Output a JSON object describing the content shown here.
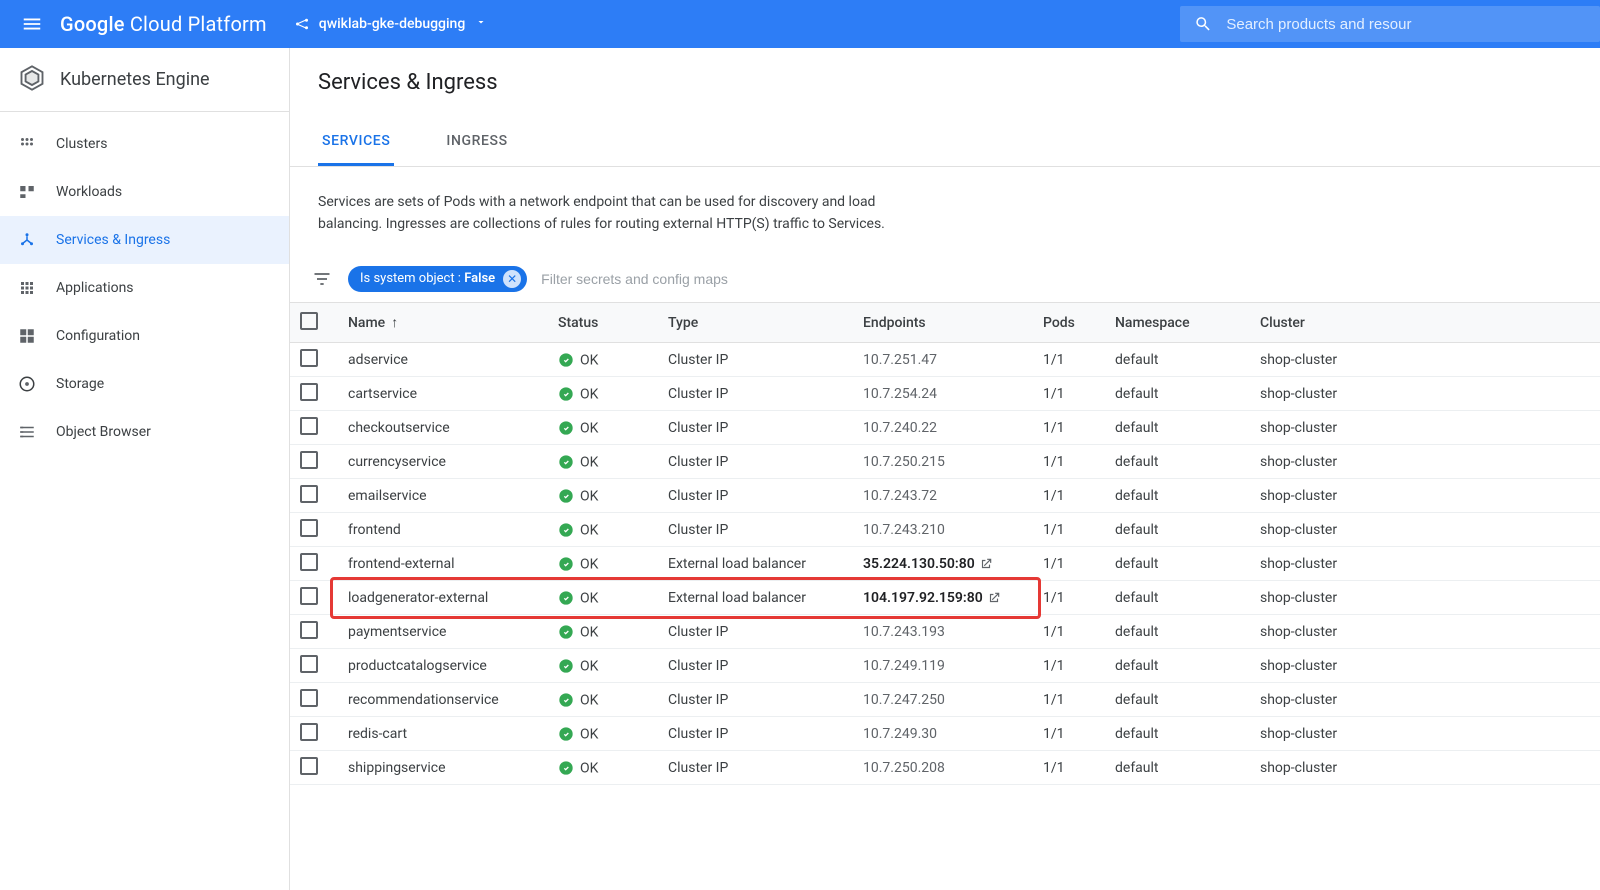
{
  "topbar": {
    "platform_name": "Google Cloud Platform",
    "project_name": "qwiklab-gke-debugging",
    "search_placeholder": "Search products and resour"
  },
  "sidebar": {
    "product": "Kubernetes Engine",
    "items": [
      {
        "label": "Clusters",
        "icon": "clusters"
      },
      {
        "label": "Workloads",
        "icon": "workloads"
      },
      {
        "label": "Services & Ingress",
        "icon": "services",
        "active": true
      },
      {
        "label": "Applications",
        "icon": "applications"
      },
      {
        "label": "Configuration",
        "icon": "configuration"
      },
      {
        "label": "Storage",
        "icon": "storage"
      },
      {
        "label": "Object Browser",
        "icon": "object-browser"
      }
    ]
  },
  "page": {
    "title": "Services & Ingress",
    "tabs": [
      {
        "label": "SERVICES",
        "active": true
      },
      {
        "label": "INGRESS"
      }
    ],
    "description": "Services are sets of Pods with a network endpoint that can be used for discovery and load balancing. Ingresses are collections of rules for routing external HTTP(S) traffic to Services.",
    "filter_chip_prefix": "Is system object : ",
    "filter_chip_value": "False",
    "filter_placeholder": "Filter secrets and config maps",
    "columns": {
      "name": "Name",
      "status": "Status",
      "type": "Type",
      "endpoints": "Endpoints",
      "pods": "Pods",
      "namespace": "Namespace",
      "cluster": "Cluster"
    },
    "rows": [
      {
        "name": "adservice",
        "status": "OK",
        "type": "Cluster IP",
        "endpoint": "10.7.251.47",
        "external": false,
        "pods": "1/1",
        "namespace": "default",
        "cluster": "shop-cluster"
      },
      {
        "name": "cartservice",
        "status": "OK",
        "type": "Cluster IP",
        "endpoint": "10.7.254.24",
        "external": false,
        "pods": "1/1",
        "namespace": "default",
        "cluster": "shop-cluster"
      },
      {
        "name": "checkoutservice",
        "status": "OK",
        "type": "Cluster IP",
        "endpoint": "10.7.240.22",
        "external": false,
        "pods": "1/1",
        "namespace": "default",
        "cluster": "shop-cluster"
      },
      {
        "name": "currencyservice",
        "status": "OK",
        "type": "Cluster IP",
        "endpoint": "10.7.250.215",
        "external": false,
        "pods": "1/1",
        "namespace": "default",
        "cluster": "shop-cluster"
      },
      {
        "name": "emailservice",
        "status": "OK",
        "type": "Cluster IP",
        "endpoint": "10.7.243.72",
        "external": false,
        "pods": "1/1",
        "namespace": "default",
        "cluster": "shop-cluster"
      },
      {
        "name": "frontend",
        "status": "OK",
        "type": "Cluster IP",
        "endpoint": "10.7.243.210",
        "external": false,
        "pods": "1/1",
        "namespace": "default",
        "cluster": "shop-cluster"
      },
      {
        "name": "frontend-external",
        "status": "OK",
        "type": "External load balancer",
        "endpoint": "35.224.130.50:80",
        "external": true,
        "pods": "1/1",
        "namespace": "default",
        "cluster": "shop-cluster"
      },
      {
        "name": "loadgenerator-external",
        "status": "OK",
        "type": "External load balancer",
        "endpoint": "104.197.92.159:80",
        "external": true,
        "pods": "1/1",
        "namespace": "default",
        "cluster": "shop-cluster",
        "highlighted": true
      },
      {
        "name": "paymentservice",
        "status": "OK",
        "type": "Cluster IP",
        "endpoint": "10.7.243.193",
        "external": false,
        "pods": "1/1",
        "namespace": "default",
        "cluster": "shop-cluster"
      },
      {
        "name": "productcatalogservice",
        "status": "OK",
        "type": "Cluster IP",
        "endpoint": "10.7.249.119",
        "external": false,
        "pods": "1/1",
        "namespace": "default",
        "cluster": "shop-cluster"
      },
      {
        "name": "recommendationservice",
        "status": "OK",
        "type": "Cluster IP",
        "endpoint": "10.7.247.250",
        "external": false,
        "pods": "1/1",
        "namespace": "default",
        "cluster": "shop-cluster"
      },
      {
        "name": "redis-cart",
        "status": "OK",
        "type": "Cluster IP",
        "endpoint": "10.7.249.30",
        "external": false,
        "pods": "1/1",
        "namespace": "default",
        "cluster": "shop-cluster"
      },
      {
        "name": "shippingservice",
        "status": "OK",
        "type": "Cluster IP",
        "endpoint": "10.7.250.208",
        "external": false,
        "pods": "1/1",
        "namespace": "default",
        "cluster": "shop-cluster"
      }
    ]
  }
}
